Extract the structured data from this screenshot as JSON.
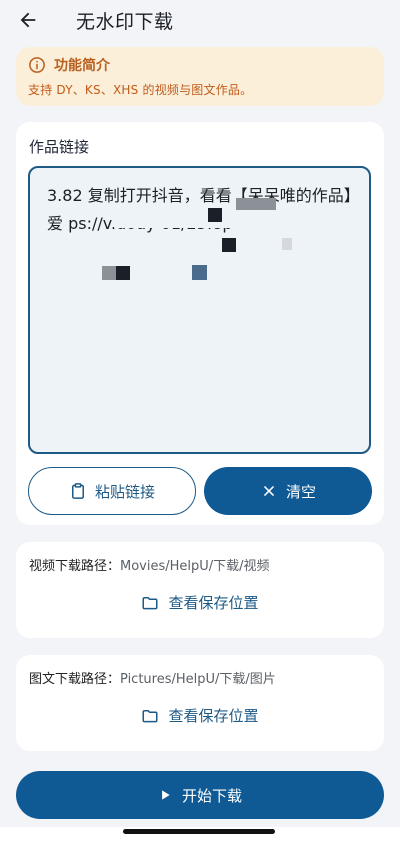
{
  "header": {
    "title": "无水印下载"
  },
  "info": {
    "title": "功能简介",
    "text": "支持 DY、KS、XHS 的视频与图文作品。"
  },
  "link": {
    "label": "作品链接",
    "value": "3.82 复制打开抖音，看看【呆呆唯的作品】爱        ps://v.douy                    01/25:8p"
  },
  "buttons": {
    "paste_label": "粘贴链接",
    "clear_label": "清空",
    "start_label": "开始下载"
  },
  "video_path": {
    "label": "视频下载路径：",
    "value": "Movies/HelpU/下载/视频",
    "action": "查看保存位置"
  },
  "image_path": {
    "label": "图文下载路径：",
    "value": "Pictures/HelpU/下载/图片",
    "action": "查看保存位置"
  },
  "colors": {
    "primary": "#0f5a95",
    "banner_bg": "#fcefd9",
    "banner_text": "#c15b1a",
    "background": "#f2f4f7"
  }
}
